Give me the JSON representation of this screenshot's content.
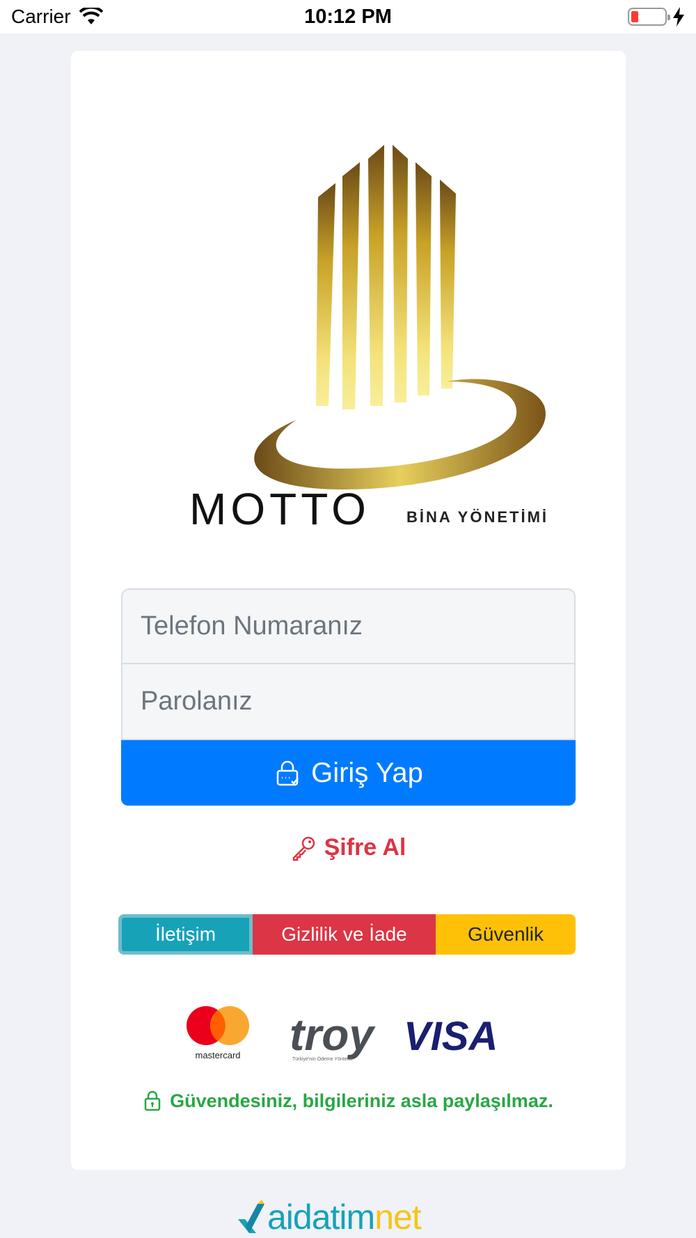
{
  "status_bar": {
    "carrier": "Carrier",
    "time": "10:12 PM"
  },
  "icons": {
    "wifi": "wifi-icon",
    "battery": "battery-icon",
    "charging": "bolt-icon",
    "login": "lock-icon",
    "forgot": "key-icon",
    "secure": "lock-icon"
  },
  "logo": {
    "brand": "MOTTO",
    "tagline": "BİNA YÖNETİMİ"
  },
  "form": {
    "phone_placeholder": "Telefon Numaranız",
    "password_placeholder": "Parolanız",
    "login_label": "Giriş Yap"
  },
  "forgot_label": "Şifre Al",
  "tabs": {
    "contact": "İletişim",
    "privacy": "Gizlilik ve İade",
    "security": "Güvenlik"
  },
  "payments": {
    "mastercard": "mastercard",
    "troy": "troy",
    "troy_tagline": "Türkiye'nin Ödeme Yöntemi",
    "visa": "VISA"
  },
  "secure_note": "Güvendesiniz, bilgileriniz asla paylaşılmaz.",
  "footer": {
    "brand_main": "aidatim",
    "brand_accent": "net"
  },
  "colors": {
    "primary": "#007bff",
    "danger": "#dc3545",
    "info": "#17a2b8",
    "warning": "#ffc107",
    "success": "#28a745",
    "gold": "#c9a227"
  }
}
